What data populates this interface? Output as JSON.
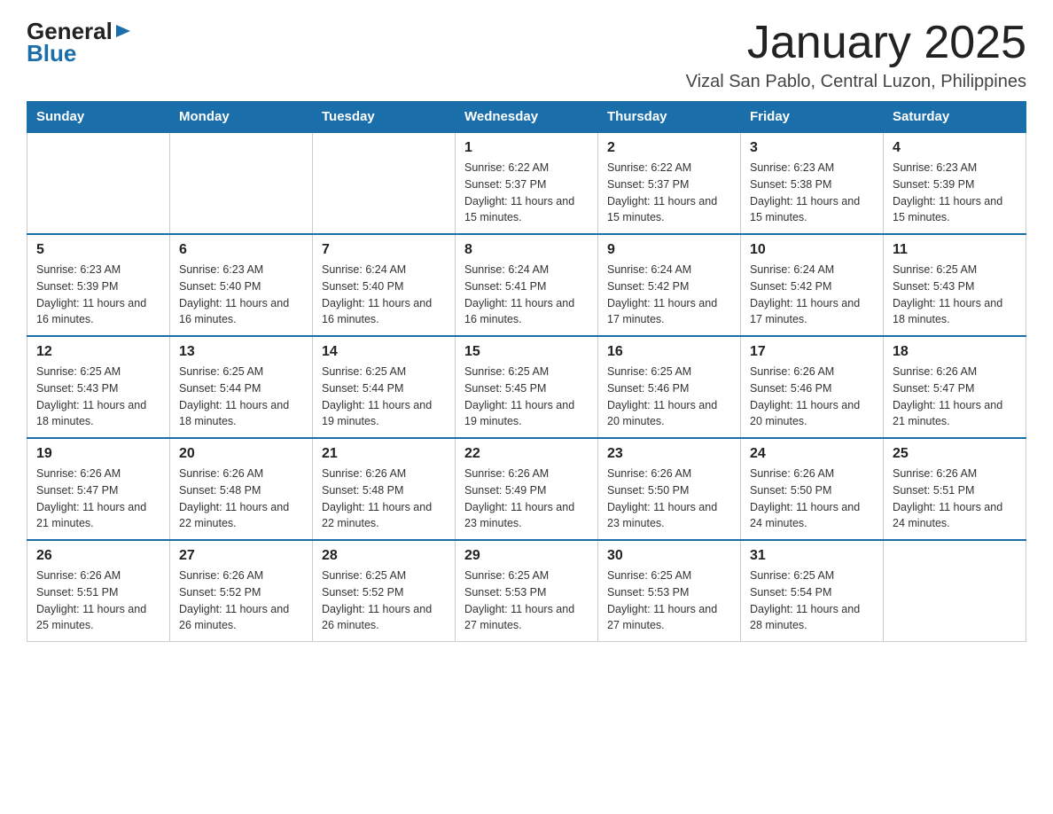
{
  "header": {
    "logo": {
      "general": "General",
      "blue": "Blue",
      "triangle": "▶"
    },
    "title": "January 2025",
    "subtitle": "Vizal San Pablo, Central Luzon, Philippines"
  },
  "calendar": {
    "days_of_week": [
      "Sunday",
      "Monday",
      "Tuesday",
      "Wednesday",
      "Thursday",
      "Friday",
      "Saturday"
    ],
    "weeks": [
      [
        {
          "day": "",
          "sunrise": "",
          "sunset": "",
          "daylight": ""
        },
        {
          "day": "",
          "sunrise": "",
          "sunset": "",
          "daylight": ""
        },
        {
          "day": "",
          "sunrise": "",
          "sunset": "",
          "daylight": ""
        },
        {
          "day": "1",
          "sunrise": "Sunrise: 6:22 AM",
          "sunset": "Sunset: 5:37 PM",
          "daylight": "Daylight: 11 hours and 15 minutes."
        },
        {
          "day": "2",
          "sunrise": "Sunrise: 6:22 AM",
          "sunset": "Sunset: 5:37 PM",
          "daylight": "Daylight: 11 hours and 15 minutes."
        },
        {
          "day": "3",
          "sunrise": "Sunrise: 6:23 AM",
          "sunset": "Sunset: 5:38 PM",
          "daylight": "Daylight: 11 hours and 15 minutes."
        },
        {
          "day": "4",
          "sunrise": "Sunrise: 6:23 AM",
          "sunset": "Sunset: 5:39 PM",
          "daylight": "Daylight: 11 hours and 15 minutes."
        }
      ],
      [
        {
          "day": "5",
          "sunrise": "Sunrise: 6:23 AM",
          "sunset": "Sunset: 5:39 PM",
          "daylight": "Daylight: 11 hours and 16 minutes."
        },
        {
          "day": "6",
          "sunrise": "Sunrise: 6:23 AM",
          "sunset": "Sunset: 5:40 PM",
          "daylight": "Daylight: 11 hours and 16 minutes."
        },
        {
          "day": "7",
          "sunrise": "Sunrise: 6:24 AM",
          "sunset": "Sunset: 5:40 PM",
          "daylight": "Daylight: 11 hours and 16 minutes."
        },
        {
          "day": "8",
          "sunrise": "Sunrise: 6:24 AM",
          "sunset": "Sunset: 5:41 PM",
          "daylight": "Daylight: 11 hours and 16 minutes."
        },
        {
          "day": "9",
          "sunrise": "Sunrise: 6:24 AM",
          "sunset": "Sunset: 5:42 PM",
          "daylight": "Daylight: 11 hours and 17 minutes."
        },
        {
          "day": "10",
          "sunrise": "Sunrise: 6:24 AM",
          "sunset": "Sunset: 5:42 PM",
          "daylight": "Daylight: 11 hours and 17 minutes."
        },
        {
          "day": "11",
          "sunrise": "Sunrise: 6:25 AM",
          "sunset": "Sunset: 5:43 PM",
          "daylight": "Daylight: 11 hours and 18 minutes."
        }
      ],
      [
        {
          "day": "12",
          "sunrise": "Sunrise: 6:25 AM",
          "sunset": "Sunset: 5:43 PM",
          "daylight": "Daylight: 11 hours and 18 minutes."
        },
        {
          "day": "13",
          "sunrise": "Sunrise: 6:25 AM",
          "sunset": "Sunset: 5:44 PM",
          "daylight": "Daylight: 11 hours and 18 minutes."
        },
        {
          "day": "14",
          "sunrise": "Sunrise: 6:25 AM",
          "sunset": "Sunset: 5:44 PM",
          "daylight": "Daylight: 11 hours and 19 minutes."
        },
        {
          "day": "15",
          "sunrise": "Sunrise: 6:25 AM",
          "sunset": "Sunset: 5:45 PM",
          "daylight": "Daylight: 11 hours and 19 minutes."
        },
        {
          "day": "16",
          "sunrise": "Sunrise: 6:25 AM",
          "sunset": "Sunset: 5:46 PM",
          "daylight": "Daylight: 11 hours and 20 minutes."
        },
        {
          "day": "17",
          "sunrise": "Sunrise: 6:26 AM",
          "sunset": "Sunset: 5:46 PM",
          "daylight": "Daylight: 11 hours and 20 minutes."
        },
        {
          "day": "18",
          "sunrise": "Sunrise: 6:26 AM",
          "sunset": "Sunset: 5:47 PM",
          "daylight": "Daylight: 11 hours and 21 minutes."
        }
      ],
      [
        {
          "day": "19",
          "sunrise": "Sunrise: 6:26 AM",
          "sunset": "Sunset: 5:47 PM",
          "daylight": "Daylight: 11 hours and 21 minutes."
        },
        {
          "day": "20",
          "sunrise": "Sunrise: 6:26 AM",
          "sunset": "Sunset: 5:48 PM",
          "daylight": "Daylight: 11 hours and 22 minutes."
        },
        {
          "day": "21",
          "sunrise": "Sunrise: 6:26 AM",
          "sunset": "Sunset: 5:48 PM",
          "daylight": "Daylight: 11 hours and 22 minutes."
        },
        {
          "day": "22",
          "sunrise": "Sunrise: 6:26 AM",
          "sunset": "Sunset: 5:49 PM",
          "daylight": "Daylight: 11 hours and 23 minutes."
        },
        {
          "day": "23",
          "sunrise": "Sunrise: 6:26 AM",
          "sunset": "Sunset: 5:50 PM",
          "daylight": "Daylight: 11 hours and 23 minutes."
        },
        {
          "day": "24",
          "sunrise": "Sunrise: 6:26 AM",
          "sunset": "Sunset: 5:50 PM",
          "daylight": "Daylight: 11 hours and 24 minutes."
        },
        {
          "day": "25",
          "sunrise": "Sunrise: 6:26 AM",
          "sunset": "Sunset: 5:51 PM",
          "daylight": "Daylight: 11 hours and 24 minutes."
        }
      ],
      [
        {
          "day": "26",
          "sunrise": "Sunrise: 6:26 AM",
          "sunset": "Sunset: 5:51 PM",
          "daylight": "Daylight: 11 hours and 25 minutes."
        },
        {
          "day": "27",
          "sunrise": "Sunrise: 6:26 AM",
          "sunset": "Sunset: 5:52 PM",
          "daylight": "Daylight: 11 hours and 26 minutes."
        },
        {
          "day": "28",
          "sunrise": "Sunrise: 6:25 AM",
          "sunset": "Sunset: 5:52 PM",
          "daylight": "Daylight: 11 hours and 26 minutes."
        },
        {
          "day": "29",
          "sunrise": "Sunrise: 6:25 AM",
          "sunset": "Sunset: 5:53 PM",
          "daylight": "Daylight: 11 hours and 27 minutes."
        },
        {
          "day": "30",
          "sunrise": "Sunrise: 6:25 AM",
          "sunset": "Sunset: 5:53 PM",
          "daylight": "Daylight: 11 hours and 27 minutes."
        },
        {
          "day": "31",
          "sunrise": "Sunrise: 6:25 AM",
          "sunset": "Sunset: 5:54 PM",
          "daylight": "Daylight: 11 hours and 28 minutes."
        },
        {
          "day": "",
          "sunrise": "",
          "sunset": "",
          "daylight": ""
        }
      ]
    ]
  }
}
